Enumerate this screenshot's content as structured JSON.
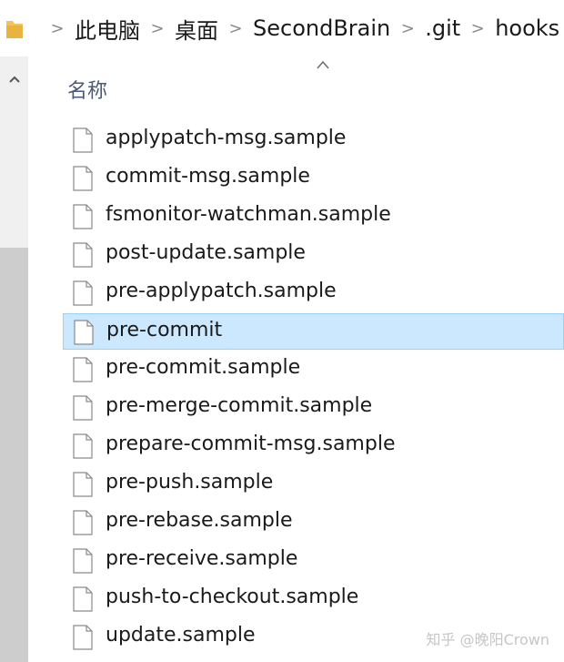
{
  "breadcrumb": {
    "items": [
      "此电脑",
      "桌面",
      "SecondBrain",
      ".git",
      "hooks"
    ],
    "separator": ">"
  },
  "column": {
    "name_label": "名称",
    "sort_indicator": "^"
  },
  "files": [
    {
      "name": "applypatch-msg.sample",
      "selected": false
    },
    {
      "name": "commit-msg.sample",
      "selected": false
    },
    {
      "name": "fsmonitor-watchman.sample",
      "selected": false
    },
    {
      "name": "post-update.sample",
      "selected": false
    },
    {
      "name": "pre-applypatch.sample",
      "selected": false
    },
    {
      "name": "pre-commit",
      "selected": true
    },
    {
      "name": "pre-commit.sample",
      "selected": false
    },
    {
      "name": "pre-merge-commit.sample",
      "selected": false
    },
    {
      "name": "prepare-commit-msg.sample",
      "selected": false
    },
    {
      "name": "pre-push.sample",
      "selected": false
    },
    {
      "name": "pre-rebase.sample",
      "selected": false
    },
    {
      "name": "pre-receive.sample",
      "selected": false
    },
    {
      "name": "push-to-checkout.sample",
      "selected": false
    },
    {
      "name": "update.sample",
      "selected": false
    }
  ],
  "watermark": "知乎 @晚阳Crown",
  "colors": {
    "selection_fill": "#cce8ff",
    "selection_border": "#99d1ff",
    "header_text": "#4a5a75",
    "folder": "#f2c45a"
  },
  "icons": {
    "folder": "folder-icon",
    "file": "file-icon",
    "breadcrumb_separator": "chevron-right-icon",
    "scroll_up": "chevron-up-icon",
    "sort": "sort-ascending-icon"
  }
}
